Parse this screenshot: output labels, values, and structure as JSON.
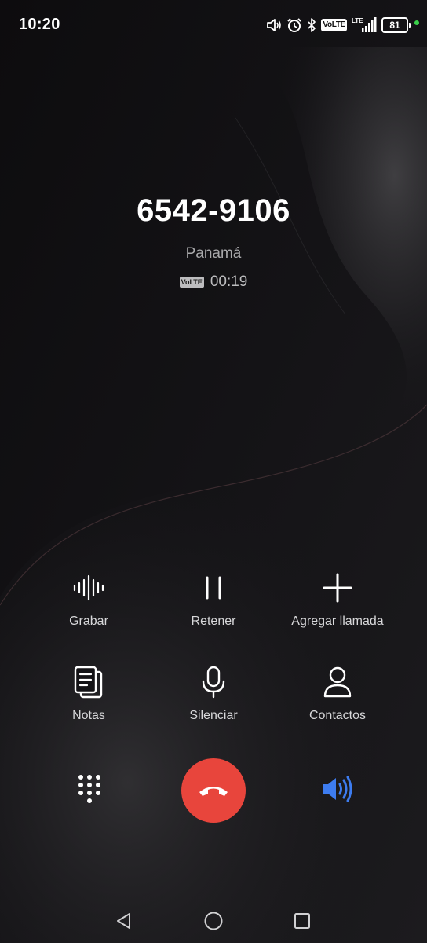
{
  "status_bar": {
    "time": "10:20",
    "icons": [
      "speaker-volume-icon",
      "alarm-icon",
      "bluetooth-icon",
      "volte-icon",
      "lte-signal-icon",
      "battery-icon"
    ],
    "volte_label": "VoLTE",
    "lte_label": "LTE",
    "battery_level": "81",
    "charging_indicator_color": "#3ad14a"
  },
  "call": {
    "number": "6542-9106",
    "location": "Panamá",
    "volte_badge": "VoLTE",
    "duration": "00:19"
  },
  "actions": [
    {
      "label": "Grabar",
      "icon": "record-waveform-icon"
    },
    {
      "label": "Retener",
      "icon": "pause-icon"
    },
    {
      "label": "Agregar llamada",
      "icon": "plus-icon"
    },
    {
      "label": "Notas",
      "icon": "notes-icon"
    },
    {
      "label": "Silenciar",
      "icon": "microphone-icon"
    },
    {
      "label": "Contactos",
      "icon": "contact-person-icon"
    }
  ],
  "controls": {
    "dialpad_icon": "dialpad-icon",
    "end_call_icon": "hang-up-icon",
    "end_call_color": "#e8453c",
    "speaker_icon": "speaker-icon",
    "speaker_active_color": "#3d7cf0"
  },
  "navigation": {
    "buttons": [
      "back-icon",
      "home-icon",
      "recents-icon"
    ]
  }
}
